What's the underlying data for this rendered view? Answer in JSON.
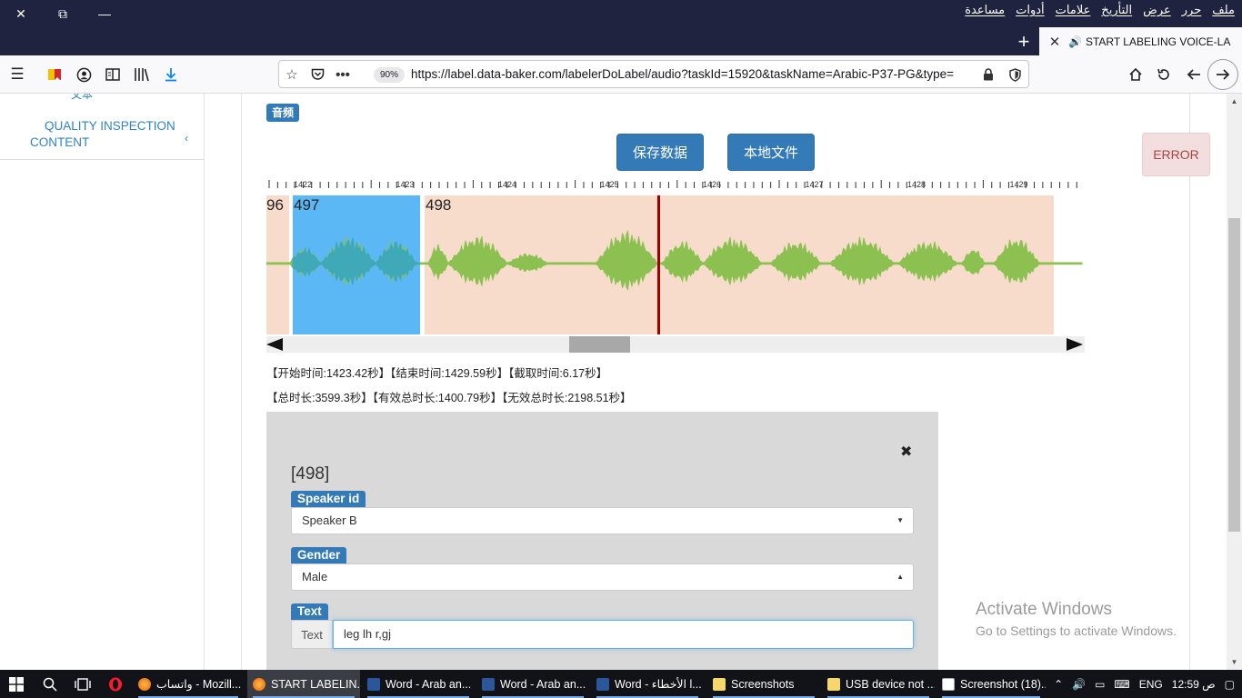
{
  "window": {
    "menu": [
      "ملف",
      "حرر",
      "عرض",
      "التأريخ",
      "علامات",
      "أدوات",
      "مساعدة"
    ],
    "tab_title": "START LABELING VOICE-LA",
    "url": "https://label.data-baker.com/labelerDoLabel/audio?taskId=15920&taskName=Arabic-P37-PG&type=",
    "zoom": "90%"
  },
  "sidebar": {
    "cut_text": "文本",
    "quality_inspection_line1": "QUALITY INSPECTION",
    "quality_inspection_line2": "CONTENT"
  },
  "main": {
    "audio_label": "音频",
    "save_button": "保存数据",
    "local_file_button": "本地文件",
    "error_button": "ERROR",
    "timeline_ticks": [
      "1425",
      "1426",
      "1427",
      "1428",
      "1429"
    ],
    "segment_labels": [
      "96",
      "497",
      "498"
    ],
    "info_line1": "【开始时间:1423.42秒】【结束时间:1429.59秒】【截取时间:6.17秒】",
    "info_line2": "【总时长:3599.3秒】【有效总时长:1400.79秒】【无效总时长:2198.51秒】"
  },
  "dialog": {
    "title": "[498]",
    "speaker_label": "Speaker id",
    "speaker_value": "Speaker B",
    "gender_label": "Gender",
    "gender_value": "Male",
    "text_label": "Text",
    "text_addon": "Text",
    "text_value": "leg lh r,gj"
  },
  "watermark": {
    "line1": "Activate Windows",
    "line2": "Go to Settings to activate Windows."
  },
  "taskbar": {
    "items": [
      "واتساب - Mozill...",
      "START LABELIN...",
      "Word - Arab an...",
      "Word - Arab an...",
      "Word - الأخطاء l...",
      "Screenshots",
      "USB device not ...",
      "Screenshot (18)..."
    ],
    "language": "ENG",
    "time": "12:59 ص"
  },
  "colors": {
    "accent": "#337ab7",
    "waveform": "#8cc152",
    "selection": "#5bb8f5",
    "segment_bg": "#f7dccb",
    "cursor": "#a00000"
  }
}
